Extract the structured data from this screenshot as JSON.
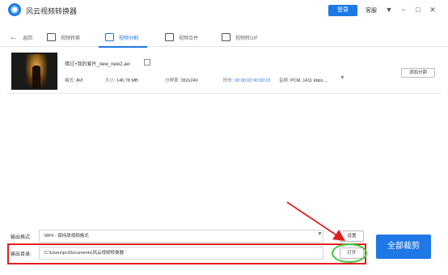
{
  "app": {
    "title": "风云视频转换器"
  },
  "header": {
    "login_label": "登录",
    "service_label": "客服",
    "menu_icon": "▼",
    "minimize_icon": "−",
    "maximize_icon": "□",
    "close_icon": "✕"
  },
  "nav": {
    "back_label": "返回",
    "tabs": [
      {
        "label": "视频转换",
        "active": false
      },
      {
        "label": "视频分割",
        "active": true
      },
      {
        "label": "视频合并",
        "active": false
      },
      {
        "label": "视频转GIF",
        "active": false
      }
    ]
  },
  "file": {
    "name": "错过+我的爱片_new_new2.avi",
    "format_label": "格式:",
    "format_value": "AVI",
    "size_label": "大小:",
    "size_value": "146.78 MB",
    "resolution_label": "分辨率:",
    "resolution_value": "352x240",
    "duration_label": "时长:",
    "duration_value": "00:00:02 00:00:15",
    "audio_label": "音频:",
    "audio_value": "PCM, 1411 kbps,...",
    "split_button": "添加分割"
  },
  "output": {
    "format_label": "输出格式:",
    "format_value": "MP4 - 保持原视频格式",
    "settings_button": "设置",
    "dir_label": "输出目录:",
    "dir_value": "C:\\Users\\pc\\Documents\\风云视频转换器",
    "open_button": "打开",
    "all_button": "全部裁剪"
  },
  "colors": {
    "accent": "#1e78e6",
    "highlight_red": "#e02020",
    "highlight_green": "#3cc83c"
  }
}
